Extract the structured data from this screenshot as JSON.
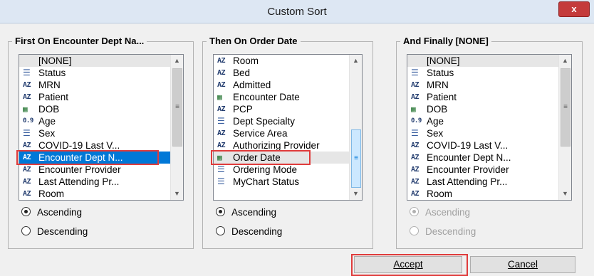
{
  "window": {
    "title": "Custom Sort",
    "close_label": "x"
  },
  "groups": [
    {
      "title": "First On Encounter Dept Na...",
      "items": [
        {
          "label": "[NONE]",
          "icon": ""
        },
        {
          "label": "Status",
          "icon": "list-icon"
        },
        {
          "label": "MRN",
          "icon": "az-icon"
        },
        {
          "label": "Patient",
          "icon": "az-icon"
        },
        {
          "label": "DOB",
          "icon": "calendar-icon"
        },
        {
          "label": "Age",
          "icon": "number-icon"
        },
        {
          "label": "Sex",
          "icon": "list-icon"
        },
        {
          "label": "COVID-19 Last V...",
          "icon": "az-icon"
        },
        {
          "label": "Encounter Dept N...",
          "icon": "az-icon"
        },
        {
          "label": "Encounter Provider",
          "icon": "az-icon"
        },
        {
          "label": "Last Attending Pr...",
          "icon": "az-icon"
        },
        {
          "label": "Room",
          "icon": "az-icon"
        }
      ],
      "ascending_label": "Ascending",
      "descending_label": "Descending",
      "selected_order": "Ascending"
    },
    {
      "title": "Then On Order Date",
      "items": [
        {
          "label": "Room",
          "icon": "az-icon"
        },
        {
          "label": "Bed",
          "icon": "az-icon"
        },
        {
          "label": "Admitted",
          "icon": "az-icon"
        },
        {
          "label": "Encounter Date",
          "icon": "calendar-icon"
        },
        {
          "label": "PCP",
          "icon": "az-icon"
        },
        {
          "label": "Dept Specialty",
          "icon": "list-icon"
        },
        {
          "label": "Service Area",
          "icon": "az-icon"
        },
        {
          "label": "Authorizing Provider",
          "icon": "az-icon"
        },
        {
          "label": "Order Date",
          "icon": "calendar-icon"
        },
        {
          "label": "Ordering Mode",
          "icon": "list-icon"
        },
        {
          "label": "MyChart Status",
          "icon": "list-icon"
        }
      ],
      "ascending_label": "Ascending",
      "descending_label": "Descending",
      "selected_order": "Ascending"
    },
    {
      "title": "And Finally [NONE]",
      "items": [
        {
          "label": "[NONE]",
          "icon": ""
        },
        {
          "label": "Status",
          "icon": "list-icon"
        },
        {
          "label": "MRN",
          "icon": "az-icon"
        },
        {
          "label": "Patient",
          "icon": "az-icon"
        },
        {
          "label": "DOB",
          "icon": "calendar-icon"
        },
        {
          "label": "Age",
          "icon": "number-icon"
        },
        {
          "label": "Sex",
          "icon": "list-icon"
        },
        {
          "label": "COVID-19 Last V...",
          "icon": "az-icon"
        },
        {
          "label": "Encounter Dept N...",
          "icon": "az-icon"
        },
        {
          "label": "Encounter Provider",
          "icon": "az-icon"
        },
        {
          "label": "Last Attending Pr...",
          "icon": "az-icon"
        },
        {
          "label": "Room",
          "icon": "az-icon"
        }
      ],
      "ascending_label": "Ascending",
      "descending_label": "Descending",
      "selected_order": "Ascending"
    }
  ],
  "buttons": {
    "accept": "Accept",
    "cancel": "Cancel"
  },
  "icon_glyphs": {
    "az-icon": "AZ",
    "list-icon": "☰",
    "calendar-icon": "▦",
    "number-icon": "0.9"
  },
  "colors": {
    "selection": "#0078d7",
    "highlight_box": "#e03c3c"
  }
}
